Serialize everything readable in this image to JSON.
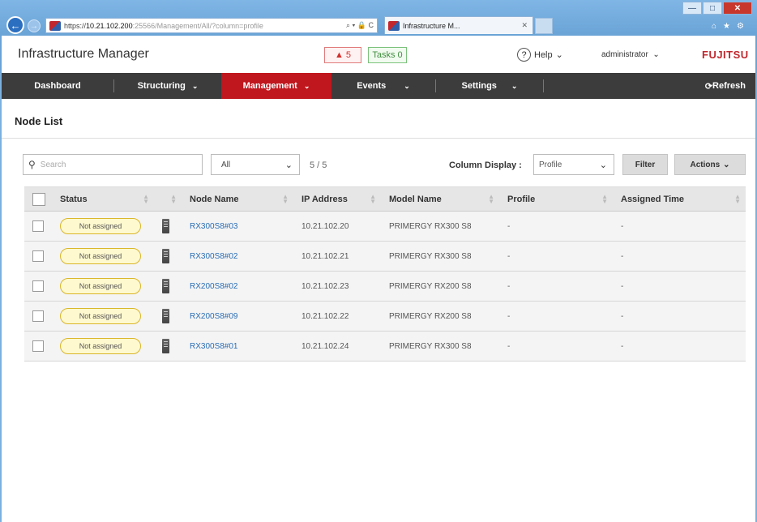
{
  "browser": {
    "url_prefix": "https://",
    "url_host": "10.21.102.200",
    "url_rest": ":25566/Management/All/?column=profile",
    "tab_title": "Infrastructure M...",
    "controls": "⌕ ▾ 🔒 C"
  },
  "header": {
    "app_title": "Infrastructure Manager",
    "alert_count": "5",
    "tasks_label": "Tasks 0",
    "help_label": "Help",
    "user_label": "administrator",
    "logo": "FUJITSU"
  },
  "nav": {
    "dashboard": "Dashboard",
    "structuring": "Structuring",
    "management": "Management",
    "events": "Events",
    "settings": "Settings",
    "refresh": "Refresh"
  },
  "page": {
    "title": "Node List"
  },
  "toolbar": {
    "search_placeholder": "Search",
    "filter_value": "All",
    "count": "5 / 5",
    "column_display_label": "Column Display :",
    "column_display_value": "Profile",
    "filter_button": "Filter",
    "actions_button": "Actions"
  },
  "table": {
    "columns": {
      "status": "Status",
      "node_name": "Node Name",
      "ip_address": "IP Address",
      "model_name": "Model Name",
      "profile": "Profile",
      "assigned_time": "Assigned Time"
    },
    "rows": [
      {
        "status": "Not assigned",
        "node_name": "RX300S8#03",
        "ip": "10.21.102.20",
        "model": "PRIMERGY RX300 S8",
        "profile": "-",
        "time": "-"
      },
      {
        "status": "Not assigned",
        "node_name": "RX300S8#02",
        "ip": "10.21.102.21",
        "model": "PRIMERGY RX300 S8",
        "profile": "-",
        "time": "-"
      },
      {
        "status": "Not assigned",
        "node_name": "RX200S8#02",
        "ip": "10.21.102.23",
        "model": "PRIMERGY RX200 S8",
        "profile": "-",
        "time": "-"
      },
      {
        "status": "Not assigned",
        "node_name": "RX200S8#09",
        "ip": "10.21.102.22",
        "model": "PRIMERGY RX200 S8",
        "profile": "-",
        "time": "-"
      },
      {
        "status": "Not assigned",
        "node_name": "RX300S8#01",
        "ip": "10.21.102.24",
        "model": "PRIMERGY RX300 S8",
        "profile": "-",
        "time": "-"
      }
    ]
  },
  "colors": {
    "nav_bg": "#3c3c3c",
    "nav_active": "#c0161d",
    "brand_red": "#c1272d",
    "status_badge_bg": "#fff9cf",
    "link": "#2a6db5"
  }
}
